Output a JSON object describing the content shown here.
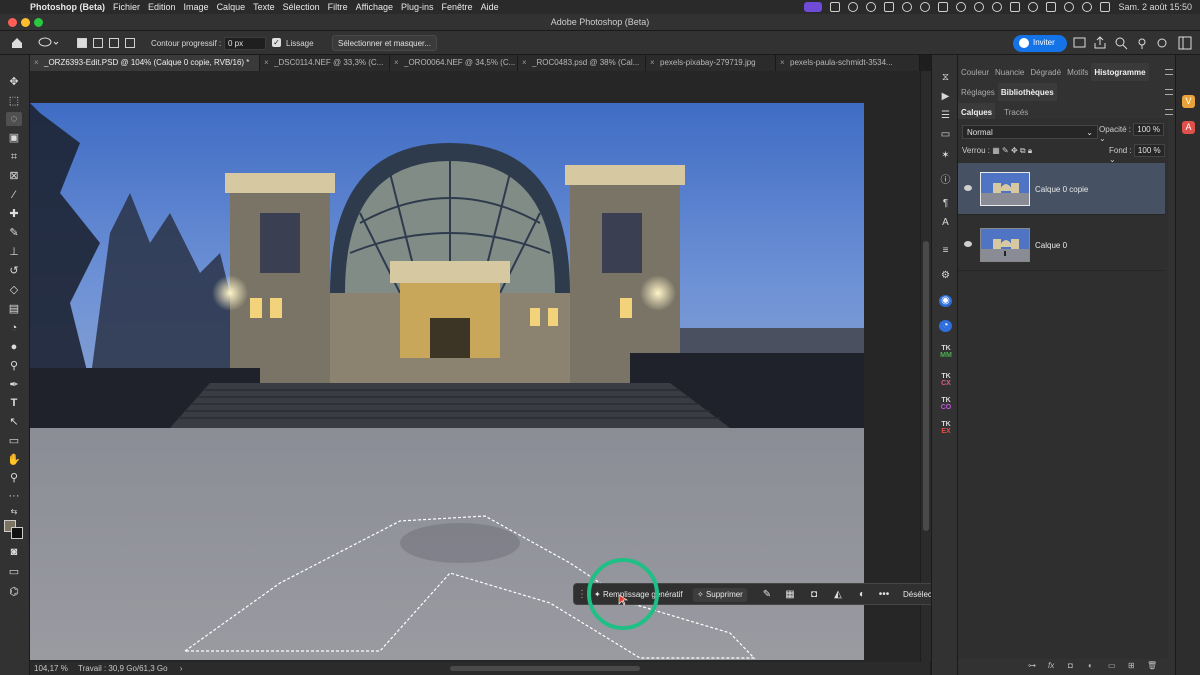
{
  "menubar": {
    "apple_icon": "apple-icon",
    "app": "Photoshop (Beta)",
    "items": [
      "Fichier",
      "Edition",
      "Image",
      "Calque",
      "Texte",
      "Sélection",
      "Filtre",
      "Affichage",
      "Plug-ins",
      "Fenêtre",
      "Aide"
    ],
    "datetime": "Sam. 2 août 15:50"
  },
  "window": {
    "title": "Adobe Photoshop (Beta)"
  },
  "options": {
    "feather_label": "Contour progressif :",
    "feather_value": "0 px",
    "antialias_label": "Lissage",
    "select_mask_label": "Sélectionner et masquer...",
    "invite_label": "Inviter"
  },
  "tabs": [
    "_ORZ6393-Edit.PSD @ 104% (Calque 0 copie, RVB/16) *",
    "_DSC0114.NEF @ 33,3% (C...",
    "_ORO0064.NEF @ 34,5% (C...",
    "_ROC0483.psd @ 38% (Cal...",
    "pexels-pixabay-279719.jpg",
    "pexels-paula-schmidt-3534..."
  ],
  "status": {
    "zoom": "104,17 %",
    "work": "Travail : 30,9 Go/61,3 Go",
    "arrow": "›"
  },
  "taskbar": {
    "generative_fill": "Remplissage génératif",
    "delete": "Supprimer",
    "more": "•••",
    "deselect": "Désélectionner"
  },
  "panels": {
    "top_tabs": [
      "Couleur",
      "Nuancie",
      "Dégradé",
      "Motifs",
      "Histogramme"
    ],
    "mid_tabs": [
      "Réglages",
      "Bibliothèques"
    ],
    "layer_tabs": [
      "Calques",
      "Tracés"
    ],
    "blend_mode": "Normal",
    "opacity_label": "Opacité :",
    "opacity_value": "100 %",
    "lock_label": "Verrou :",
    "fill_label": "Fond :",
    "fill_value": "100 %",
    "layers": [
      {
        "name": "Calque 0 copie",
        "selected": true
      },
      {
        "name": "Calque 0",
        "selected": false
      }
    ],
    "footer_fx": "fx"
  },
  "iconstrip": {
    "tk_labels": [
      {
        "top": "TK",
        "bottom": "MM",
        "color": "#4caf50"
      },
      {
        "top": "TK",
        "bottom": "CX",
        "color": "#e05a8a"
      },
      {
        "top": "TK",
        "bottom": "CO",
        "color": "#c05ad8"
      },
      {
        "top": "TK",
        "bottom": "EX",
        "color": "#e0504a"
      }
    ]
  },
  "colors": {
    "accent": "#1473e6",
    "highlight_ring": "#1fbf86",
    "selected_layer": "#465163"
  }
}
